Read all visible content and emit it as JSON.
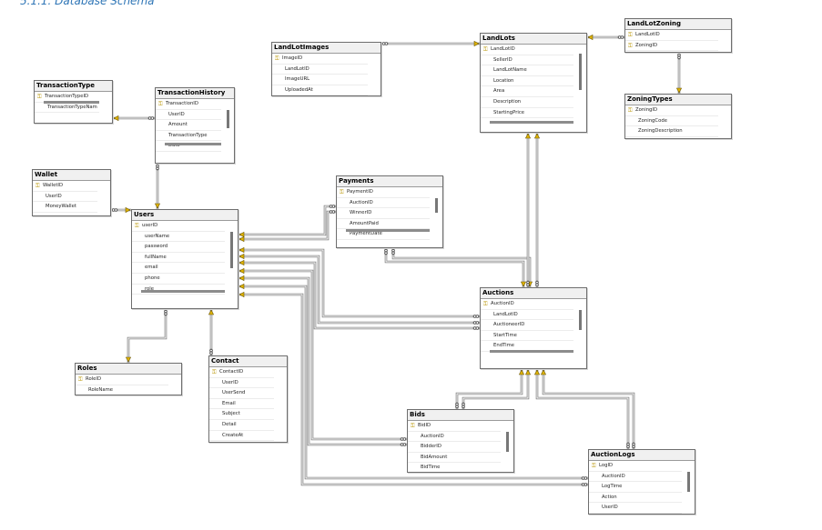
{
  "heading": "5.1.1. Database Schema",
  "tables": [
    {
      "id": "landlotimages",
      "name": "LandLotImages",
      "columns": [
        {
          "name": "ImageID",
          "pk": true
        },
        {
          "name": "LandLotID"
        },
        {
          "name": "ImageURL"
        },
        {
          "name": "UploadedAt"
        }
      ]
    },
    {
      "id": "landlots",
      "name": "LandLots",
      "columns": [
        {
          "name": "LandLotID",
          "pk": true
        },
        {
          "name": "SellerID"
        },
        {
          "name": "LandLotName"
        },
        {
          "name": "Location"
        },
        {
          "name": "Area"
        },
        {
          "name": "Description"
        },
        {
          "name": "StartingPrice"
        }
      ]
    },
    {
      "id": "landlotzoning",
      "name": "LandLotZoning",
      "columns": [
        {
          "name": "LandLotID",
          "pk": true
        },
        {
          "name": "ZoningID",
          "pk": true
        }
      ]
    },
    {
      "id": "zoningtypes",
      "name": "ZoningTypes",
      "columns": [
        {
          "name": "ZoningID",
          "pk": true
        },
        {
          "name": "ZoningCode"
        },
        {
          "name": "ZoningDescription"
        }
      ]
    },
    {
      "id": "transactiontype",
      "name": "TransactionType",
      "columns": [
        {
          "name": "TransactionTypeID",
          "pk": true
        },
        {
          "name": "TransactionTypeNam"
        }
      ]
    },
    {
      "id": "transactionhistory",
      "name": "TransactionHistory",
      "columns": [
        {
          "name": "TransactionID",
          "pk": true
        },
        {
          "name": "UserID"
        },
        {
          "name": "Amount"
        },
        {
          "name": "TransactionType"
        },
        {
          "name": "Date"
        }
      ]
    },
    {
      "id": "wallet",
      "name": "Wallet",
      "columns": [
        {
          "name": "WalletID",
          "pk": true
        },
        {
          "name": "UserID"
        },
        {
          "name": "MoneyWallet"
        }
      ]
    },
    {
      "id": "payments",
      "name": "Payments",
      "columns": [
        {
          "name": "PaymentID",
          "pk": true
        },
        {
          "name": "AuctionID"
        },
        {
          "name": "WinnerID"
        },
        {
          "name": "AmountPaid"
        },
        {
          "name": "PaymentDate"
        }
      ]
    },
    {
      "id": "users",
      "name": "Users",
      "columns": [
        {
          "name": "userID",
          "pk": true
        },
        {
          "name": "userName"
        },
        {
          "name": "password"
        },
        {
          "name": "fullName"
        },
        {
          "name": "email"
        },
        {
          "name": "phone"
        },
        {
          "name": "role"
        }
      ]
    },
    {
      "id": "auctions",
      "name": "Auctions",
      "columns": [
        {
          "name": "AuctionID",
          "pk": true
        },
        {
          "name": "LandLotID"
        },
        {
          "name": "AuctioneerID"
        },
        {
          "name": "StartTime"
        },
        {
          "name": "EndTime"
        }
      ]
    },
    {
      "id": "roles",
      "name": "Roles",
      "columns": [
        {
          "name": "RoleID",
          "pk": true
        },
        {
          "name": "RoleName"
        }
      ]
    },
    {
      "id": "contact",
      "name": "Contact",
      "columns": [
        {
          "name": "ContactID",
          "pk": true
        },
        {
          "name": "UserID"
        },
        {
          "name": "UserSend"
        },
        {
          "name": "Email"
        },
        {
          "name": "Subject"
        },
        {
          "name": "Detail"
        },
        {
          "name": "CreateAt"
        }
      ]
    },
    {
      "id": "bids",
      "name": "Bids",
      "columns": [
        {
          "name": "BidID",
          "pk": true
        },
        {
          "name": "AuctionID"
        },
        {
          "name": "BidderID"
        },
        {
          "name": "BidAmount"
        },
        {
          "name": "BidTime"
        }
      ]
    },
    {
      "id": "auctionlogs",
      "name": "AuctionLogs",
      "columns": [
        {
          "name": "LogID",
          "pk": true
        },
        {
          "name": "AuctionID"
        },
        {
          "name": "LogTime"
        },
        {
          "name": "Action"
        },
        {
          "name": "UserID"
        }
      ]
    }
  ],
  "relationships": [
    {
      "from": "landlotimages",
      "to": "landlots"
    },
    {
      "from": "landlotzoning",
      "to": "landlots"
    },
    {
      "from": "landlotzoning",
      "to": "zoningtypes"
    },
    {
      "from": "transactionhistory",
      "to": "transactiontype"
    },
    {
      "from": "transactionhistory",
      "to": "users"
    },
    {
      "from": "wallet",
      "to": "users"
    },
    {
      "from": "payments",
      "to": "users"
    },
    {
      "from": "payments",
      "to": "auctions"
    },
    {
      "from": "auctions",
      "to": "landlots"
    },
    {
      "from": "auctions",
      "to": "users"
    },
    {
      "from": "bids",
      "to": "auctions"
    },
    {
      "from": "bids",
      "to": "users"
    },
    {
      "from": "auctionlogs",
      "to": "auctions"
    },
    {
      "from": "auctionlogs",
      "to": "users"
    },
    {
      "from": "users",
      "to": "roles"
    },
    {
      "from": "contact",
      "to": "users"
    }
  ],
  "colors": {
    "line": "#808080",
    "key": "#e0b400",
    "heading": "#2e75b6"
  }
}
